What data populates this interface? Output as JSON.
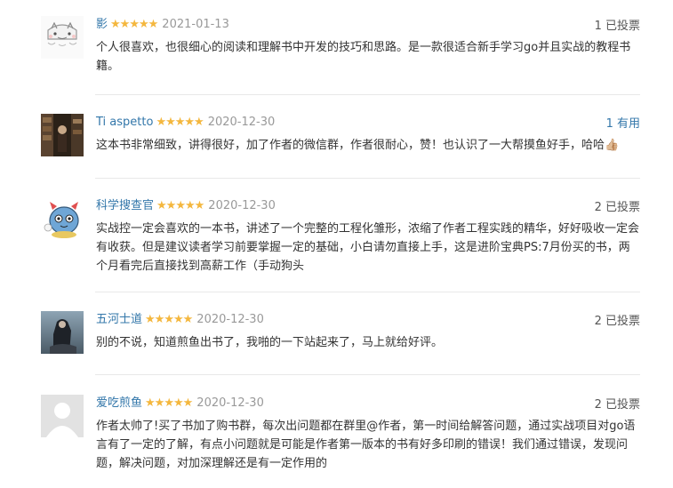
{
  "reviews": [
    {
      "name": "影",
      "stars": "★★★★★",
      "date": "2021-01-13",
      "votes": "1 已投票",
      "text": "个人很喜欢，也很细心的阅读和理解书中开发的技巧和思路。是一款很适合新手学习go并且实战的教程书籍。"
    },
    {
      "name": "Ti aspetto",
      "stars": "★★★★★",
      "date": "2020-12-30",
      "votes": "1 有用",
      "text": "这本书非常细致，讲得很好，加了作者的微信群，作者很耐心，赞！也认识了一大帮摸鱼好手，哈哈👍🏼"
    },
    {
      "name": "科学搜查官",
      "stars": "★★★★★",
      "date": "2020-12-30",
      "votes": "2 已投票",
      "text": "实战控一定会喜欢的一本书，讲述了一个完整的工程化雏形，浓缩了作者工程实践的精华，好好吸收一定会有收获。但是建议读者学习前要掌握一定的基础，小白请勿直接上手，这是进阶宝典PS:7月份买的书，两个月看完后直接找到高薪工作（手动狗头"
    },
    {
      "name": "五河士道",
      "stars": "★★★★★",
      "date": "2020-12-30",
      "votes": "2 已投票",
      "text": "别的不说，知道煎鱼出书了，我啪的一下站起来了，马上就给好评。"
    },
    {
      "name": "爱吃煎鱼",
      "stars": "★★★★★",
      "date": "2020-12-30",
      "votes": "2 已投票",
      "text": "作者太帅了!买了书加了购书群，每次出问题都在群里@作者，第一时间给解答问题，通过实战项目对go语言有了一定的了解，有点小问题就是可能是作者第一版本的书有好多印刷的错误！我们通过错误，发现问题，解决问题，对加深理解还是有一定作用的"
    }
  ]
}
